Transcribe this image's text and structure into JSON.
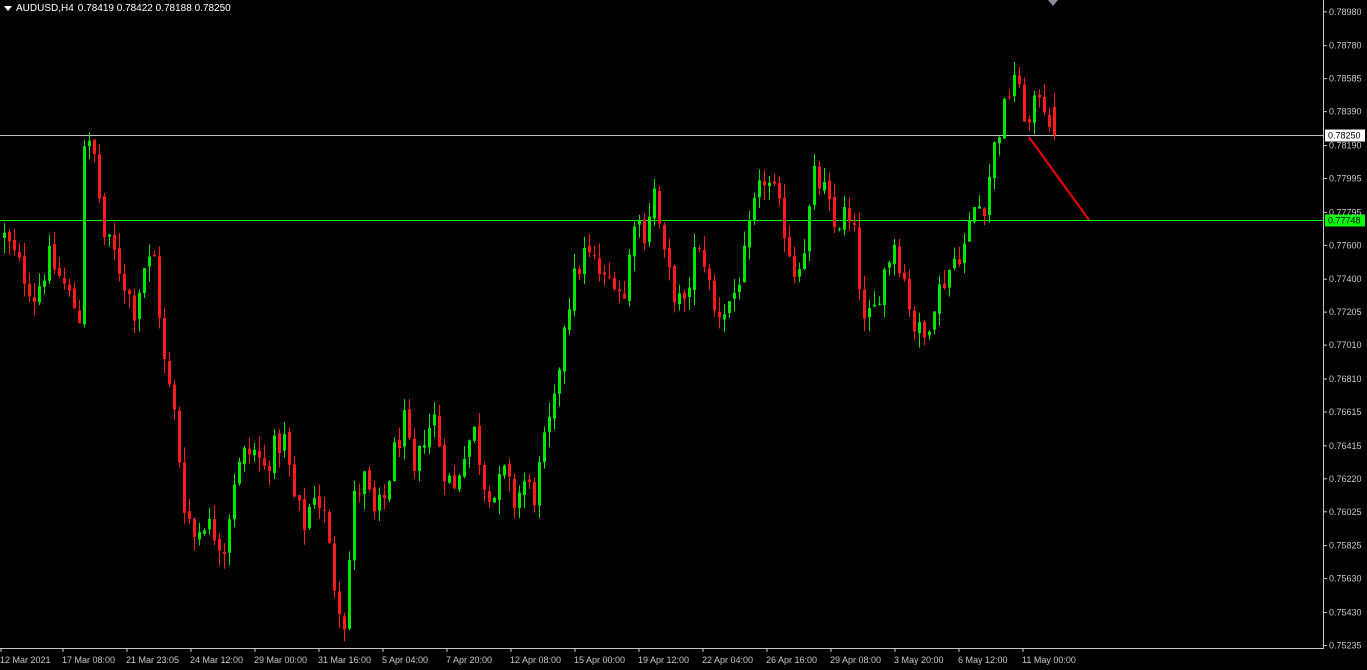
{
  "header": {
    "symbol": "AUDUSD,H4",
    "ohlc": "0.78419 0.78422 0.78188 0.78250"
  },
  "chart_data": {
    "type": "candlestick",
    "symbol": "AUDUSD",
    "timeframe": "H4",
    "ohlc_display": {
      "open": 0.78419,
      "high": 0.78422,
      "low": 0.78188,
      "close": 0.7825
    },
    "ylim": [
      0.7522,
      0.7905
    ],
    "y_ticks": [
      "0.78980",
      "0.78780",
      "0.78585",
      "0.78390",
      "0.78190",
      "0.77995",
      "0.77795",
      "0.77600",
      "0.77400",
      "0.77205",
      "0.77010",
      "0.76810",
      "0.76615",
      "0.76415",
      "0.76220",
      "0.76025",
      "0.75825",
      "0.75630",
      "0.75430",
      "0.75235"
    ],
    "x_ticks": [
      "12 Mar 2021",
      "17 Mar 08:00",
      "21 Mar 23:05",
      "24 Mar 12:00",
      "29 Mar 00:00",
      "31 Mar 16:00",
      "5 Apr 04:00",
      "7 Apr 20:00",
      "12 Apr 08:00",
      "15 Apr 00:00",
      "19 Apr 12:00",
      "22 Apr 04:00",
      "26 Apr 16:00",
      "29 Apr 08:00",
      "3 May 20:00",
      "6 May 12:00",
      "11 May 00:00"
    ],
    "horizontal_lines": [
      {
        "price": 0.7825,
        "label": "0.78250",
        "color": "#c0c0c0"
      },
      {
        "price": 0.77748,
        "label": "0.77748",
        "color": "#00ff00"
      }
    ],
    "projection_line": {
      "from_bar": 205,
      "from_price": 0.7824,
      "to_bar": 213,
      "to_price": 0.7775,
      "color": "#ff0000"
    },
    "path_points": [
      [
        0,
        0.7765
      ],
      [
        3,
        0.7748
      ],
      [
        6,
        0.773
      ],
      [
        9,
        0.7752
      ],
      [
        12,
        0.7736
      ],
      [
        15,
        0.7718
      ],
      [
        16,
        0.7822
      ],
      [
        18,
        0.7812
      ],
      [
        20,
        0.7765
      ],
      [
        22,
        0.7755
      ],
      [
        24,
        0.7738
      ],
      [
        26,
        0.7722
      ],
      [
        28,
        0.7748
      ],
      [
        30,
        0.7752
      ],
      [
        32,
        0.769
      ],
      [
        34,
        0.766
      ],
      [
        36,
        0.7608
      ],
      [
        38,
        0.7588
      ],
      [
        40,
        0.7598
      ],
      [
        42,
        0.759
      ],
      [
        44,
        0.7582
      ],
      [
        46,
        0.7622
      ],
      [
        48,
        0.7636
      ],
      [
        50,
        0.7638
      ],
      [
        52,
        0.7628
      ],
      [
        54,
        0.764
      ],
      [
        56,
        0.7645
      ],
      [
        58,
        0.761
      ],
      [
        60,
        0.7595
      ],
      [
        62,
        0.7615
      ],
      [
        64,
        0.76
      ],
      [
        66,
        0.756
      ],
      [
        68,
        0.7538
      ],
      [
        70,
        0.761
      ],
      [
        72,
        0.7622
      ],
      [
        74,
        0.76
      ],
      [
        76,
        0.761
      ],
      [
        78,
        0.7638
      ],
      [
        80,
        0.7655
      ],
      [
        82,
        0.7622
      ],
      [
        84,
        0.7648
      ],
      [
        86,
        0.7658
      ],
      [
        88,
        0.7628
      ],
      [
        90,
        0.7615
      ],
      [
        92,
        0.764
      ],
      [
        94,
        0.765
      ],
      [
        96,
        0.762
      ],
      [
        98,
        0.7612
      ],
      [
        100,
        0.7625
      ],
      [
        102,
        0.7608
      ],
      [
        104,
        0.762
      ],
      [
        106,
        0.7612
      ],
      [
        108,
        0.7642
      ],
      [
        110,
        0.7665
      ],
      [
        112,
        0.7715
      ],
      [
        114,
        0.774
      ],
      [
        116,
        0.7755
      ],
      [
        118,
        0.775
      ],
      [
        120,
        0.7738
      ],
      [
        122,
        0.7742
      ],
      [
        124,
        0.7728
      ],
      [
        126,
        0.7778
      ],
      [
        128,
        0.7768
      ],
      [
        130,
        0.7792
      ],
      [
        132,
        0.7752
      ],
      [
        134,
        0.7732
      ],
      [
        136,
        0.7722
      ],
      [
        138,
        0.7755
      ],
      [
        140,
        0.7752
      ],
      [
        142,
        0.772
      ],
      [
        144,
        0.7722
      ],
      [
        146,
        0.7732
      ],
      [
        148,
        0.7752
      ],
      [
        150,
        0.7782
      ],
      [
        152,
        0.78
      ],
      [
        154,
        0.779
      ],
      [
        156,
        0.777
      ],
      [
        158,
        0.7745
      ],
      [
        160,
        0.776
      ],
      [
        162,
        0.78
      ],
      [
        164,
        0.7792
      ],
      [
        166,
        0.777
      ],
      [
        168,
        0.7778
      ],
      [
        170,
        0.7765
      ],
      [
        172,
        0.7712
      ],
      [
        174,
        0.7722
      ],
      [
        176,
        0.7745
      ],
      [
        178,
        0.7762
      ],
      [
        180,
        0.774
      ],
      [
        182,
        0.7712
      ],
      [
        184,
        0.7705
      ],
      [
        186,
        0.7728
      ],
      [
        188,
        0.774
      ],
      [
        190,
        0.7752
      ],
      [
        192,
        0.776
      ],
      [
        194,
        0.7782
      ],
      [
        196,
        0.7785
      ],
      [
        198,
        0.7818
      ],
      [
        200,
        0.784
      ],
      [
        202,
        0.7862
      ],
      [
        203,
        0.7848
      ],
      [
        205,
        0.783
      ],
      [
        207,
        0.7852
      ],
      [
        209,
        0.7835
      ],
      [
        210,
        0.7825
      ]
    ]
  }
}
